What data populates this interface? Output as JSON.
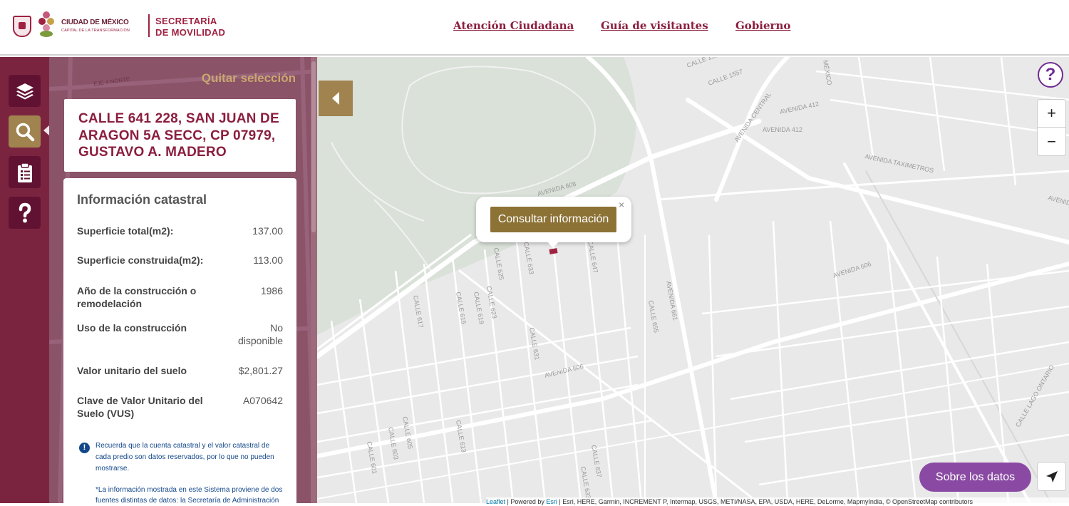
{
  "header": {
    "cdmx_title": "CIUDAD DE MÉXICO",
    "cdmx_subtitle": "CAPITAL DE LA TRANSFORMACIÓN",
    "secretaria_line1": "SECRETARÍA",
    "secretaria_line2": "DE MOVILIDAD",
    "nav": [
      {
        "label": "Atención Ciudadana"
      },
      {
        "label": "Guía de visitantes"
      },
      {
        "label": "Gobierno"
      }
    ]
  },
  "sidebar": {
    "items": [
      {
        "icon": "layers-icon"
      },
      {
        "icon": "search-icon",
        "active": true
      },
      {
        "icon": "clipboard-icon"
      },
      {
        "icon": "question-icon"
      }
    ]
  },
  "panel": {
    "clear_selection": "Quitar selección",
    "address": "CALLE 641 228, SAN JUAN DE ARAGON 5A SECC, CP 07979, GUSTAVO A. MADERO",
    "info_title": "Información catastral",
    "rows": [
      {
        "label": "Superficie total(m2):",
        "value": "137.00"
      },
      {
        "label": "Superficie construida(m2):",
        "value": "113.00"
      },
      {
        "label": "Año de la construcción o remodelación",
        "value": "1986"
      },
      {
        "label": "Uso de la construcción",
        "value": "No disponible"
      },
      {
        "label": "Valor unitario del suelo",
        "value": "$2,801.27"
      },
      {
        "label": "Clave de Valor Unitario del Suelo (VUS)",
        "value": "A070642"
      }
    ],
    "notice": "Recuerda que la cuenta catastral y el valor catastral de cada predio son datos reservados, por lo que no pueden mostrarse.",
    "notice_2": "*La información mostrada en este Sistema proviene de dos fuentes distintas de datos: la Secretaría de Administración"
  },
  "map": {
    "popup_button": "Consultar información",
    "popup_close": "×",
    "zoom_in": "+",
    "zoom_out": "−",
    "help": "?",
    "about_data": "Sobre los datos",
    "attribution_leaflet": "Leaflet",
    "attribution_esri": "Esri",
    "attribution_powered": " | Powered by ",
    "attribution_rest": " | Esri, HERE, Garmin, INCREMENT P, Intermap, USGS, METI/NASA, EPA, USDA, HERE, DeLorme, MapmyIndia, © OpenStreetMap contributors",
    "street_labels": [
      "CALLE 1555",
      "CALLE 1557",
      "AVENIDA 412",
      "AVENIDA 412",
      "AVENIDA CENTRAL",
      "AVENIDA TAXIMETROS",
      "AVENIDA 608",
      "AVENIDA 606",
      "AVENIDA 606",
      "AVENIDA 661",
      "CALLE 617",
      "CALLE 615",
      "CALLE 619",
      "CALLE 623",
      "CALLE 625",
      "CALLE 631",
      "CALLE 633",
      "CALLE 647",
      "CALLE 655",
      "CALLE 613",
      "CALLE 601",
      "CALLE 603",
      "CALLE 605",
      "CALLE 637",
      "CALLE 633",
      "MÉXICO",
      "CALLE LAGO ONTARIO",
      "AVENIDA"
    ]
  }
}
